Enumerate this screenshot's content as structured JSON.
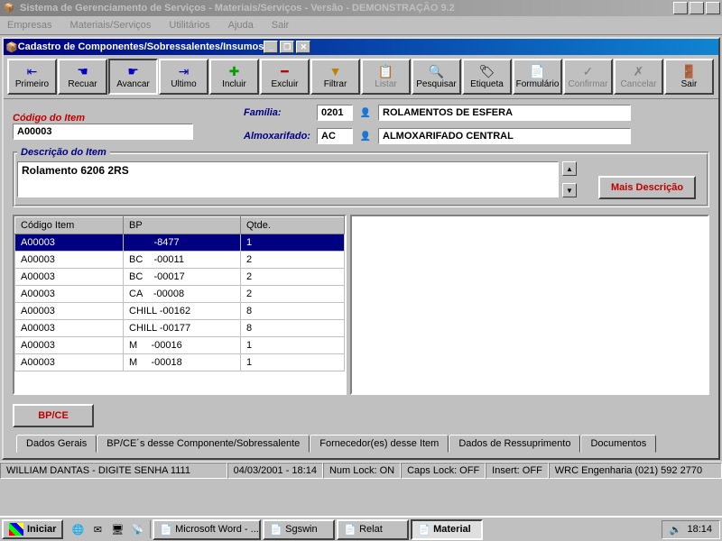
{
  "main_window": {
    "title": "Sistema de Gerenciamento de Serviços - Materiais/Serviços - Versão - DEMONSTRAÇÃO 9.2"
  },
  "menubar": {
    "empresas": "Empresas",
    "materiais": "Materiais/Serviços",
    "utilitarios": "Utilitários",
    "ajuda": "Ajuda",
    "sair": "Sair"
  },
  "child_window": {
    "title": "Cadastro de Componentes/Sobressalentes/Insumos"
  },
  "toolbar": {
    "primeiro": "Primeiro",
    "recuar": "Recuar",
    "avancar": "Avancar",
    "ultimo": "Ultimo",
    "incluir": "Incluir",
    "excluir": "Excluir",
    "filtrar": "Filtrar",
    "listar": "Listar",
    "pesquisar": "Pesquisar",
    "etiqueta": "Etiqueta",
    "formulario": "Formulário",
    "confirmar": "Confirmar",
    "cancelar": "Cancelar",
    "sair": "Sair"
  },
  "form": {
    "codigo_label": "Código do Item",
    "codigo_value": "A00003",
    "familia_label": "Família:",
    "familia_code": "0201",
    "familia_desc": "ROLAMENTOS DE ESFERA",
    "almox_label": "Almoxarifado:",
    "almox_code": "AC",
    "almox_desc": "ALMOXARIFADO CENTRAL",
    "descricao_label": "Descrição do Item",
    "descricao_value": "Rolamento 6206 2RS",
    "mais_descricao": "Mais Descrição"
  },
  "table": {
    "headers": {
      "codigo": "Código Item",
      "bp": "BP",
      "qtde": "Qtde."
    },
    "rows": [
      {
        "codigo": "A00003",
        "bp": "         -8477",
        "qtde": "1"
      },
      {
        "codigo": "A00003",
        "bp": "BC    -00011",
        "qtde": "2"
      },
      {
        "codigo": "A00003",
        "bp": "BC    -00017",
        "qtde": "2"
      },
      {
        "codigo": "A00003",
        "bp": "CA    -00008",
        "qtde": "2"
      },
      {
        "codigo": "A00003",
        "bp": "CHILL -00162",
        "qtde": "8"
      },
      {
        "codigo": "A00003",
        "bp": "CHILL -00177",
        "qtde": "8"
      },
      {
        "codigo": "A00003",
        "bp": "M     -00016",
        "qtde": "1"
      },
      {
        "codigo": "A00003",
        "bp": "M     -00018",
        "qtde": "1"
      }
    ]
  },
  "bpce_btn": "BP/CE",
  "tabs": {
    "dados_gerais": "Dados Gerais",
    "bpce": "BP/CE´s desse Componente/Sobressalente",
    "fornecedor": "Fornecedor(es) desse Item",
    "ressuprimento": "Dados de Ressuprimento",
    "documentos": "Documentos"
  },
  "statusbar": {
    "user": "WILLIAM DANTAS - DIGITE SENHA 1111",
    "datetime": "04/03/2001 - 18:14",
    "numlock": "Num Lock: ON",
    "capslock": "Caps Lock: OFF",
    "insert": "Insert: OFF",
    "company": "WRC  Engenharia  (021) 592 2770"
  },
  "taskbar": {
    "start": "Iniciar",
    "items": [
      {
        "label": "Microsoft Word - ..."
      },
      {
        "label": "Sgswin"
      },
      {
        "label": "Relat"
      },
      {
        "label": "Material"
      }
    ],
    "clock": "18:14"
  }
}
